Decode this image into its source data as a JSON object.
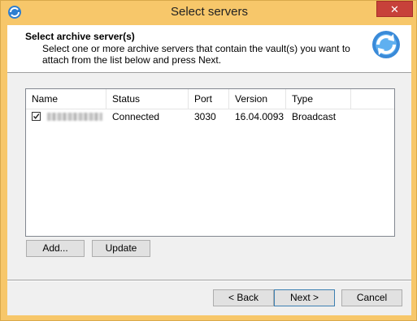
{
  "window": {
    "title": "Select servers",
    "close_label": "✕"
  },
  "header": {
    "title": "Select archive server(s)",
    "description": "Select one or more archive servers that contain the vault(s) you want to attach from the list below and press Next."
  },
  "list": {
    "columns": [
      "Name",
      "Status",
      "Port",
      "Version",
      "Type"
    ],
    "rows": [
      {
        "checked": true,
        "name": "",
        "status": "Connected",
        "port": "3030",
        "version": "16.04.0093",
        "type": "Broadcast"
      }
    ]
  },
  "buttons": {
    "add": "Add...",
    "update": "Update",
    "back": "< Back",
    "next": "Next >",
    "cancel": "Cancel"
  },
  "colors": {
    "titlebar": "#f7c76a",
    "close": "#c7413a",
    "default_border": "#3c7fb1"
  }
}
